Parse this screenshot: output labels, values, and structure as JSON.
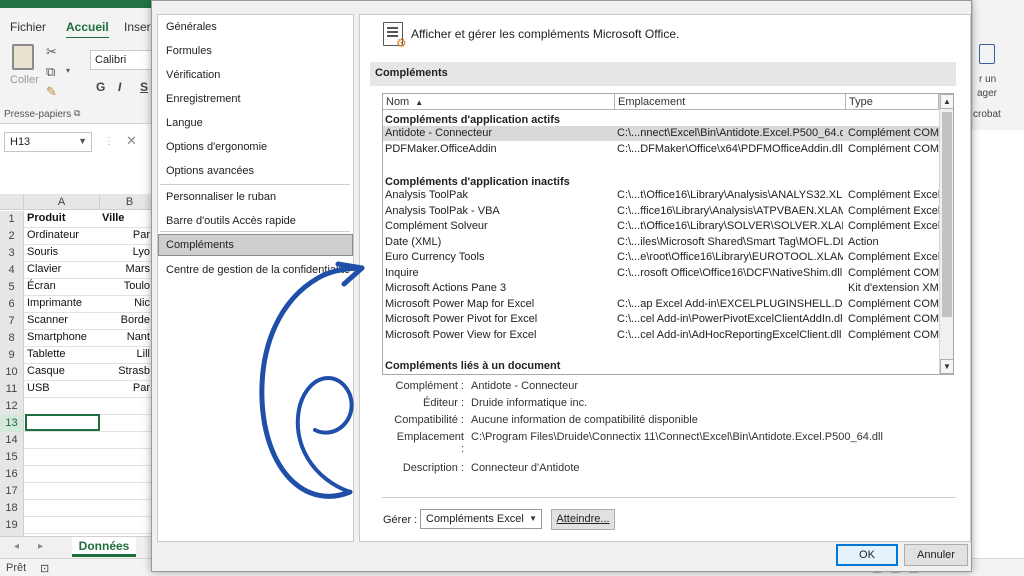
{
  "excel": {
    "tabs": [
      "Fichier",
      "Accueil",
      "Inser"
    ],
    "paste_label": "Coller",
    "font_name": "Calibri",
    "format_buttons": [
      "G",
      "I",
      "S"
    ],
    "clipboard_group": "Presse-papiers",
    "name_box": "H13",
    "right_ribbon": [
      "r un",
      "ager",
      "crobat"
    ],
    "column_headers": [
      "A",
      "B"
    ],
    "rows": [
      {
        "n": "1",
        "a": "Produit",
        "b": "Ville"
      },
      {
        "n": "2",
        "a": "Ordinateur",
        "b": "Par"
      },
      {
        "n": "3",
        "a": "Souris",
        "b": "Lyo"
      },
      {
        "n": "4",
        "a": "Clavier",
        "b": "Mars"
      },
      {
        "n": "5",
        "a": "Écran",
        "b": "Toulo"
      },
      {
        "n": "6",
        "a": "Imprimante",
        "b": "Nic"
      },
      {
        "n": "7",
        "a": "Scanner",
        "b": "Borde"
      },
      {
        "n": "8",
        "a": "Smartphone",
        "b": "Nant"
      },
      {
        "n": "9",
        "a": "Tablette",
        "b": "Lill"
      },
      {
        "n": "10",
        "a": "Casque",
        "b": "Strasb"
      },
      {
        "n": "11",
        "a": "USB",
        "b": "Par"
      },
      {
        "n": "12",
        "a": "",
        "b": ""
      },
      {
        "n": "13",
        "a": "",
        "b": ""
      },
      {
        "n": "14",
        "a": "",
        "b": ""
      },
      {
        "n": "15",
        "a": "",
        "b": ""
      },
      {
        "n": "16",
        "a": "",
        "b": ""
      },
      {
        "n": "17",
        "a": "",
        "b": ""
      },
      {
        "n": "18",
        "a": "",
        "b": ""
      },
      {
        "n": "19",
        "a": "",
        "b": ""
      },
      {
        "n": "20",
        "a": "",
        "b": ""
      }
    ],
    "sheet_tab": "Données",
    "status_ready": "Prêt"
  },
  "dialog": {
    "nav": {
      "items": [
        "Générales",
        "Formules",
        "Vérification",
        "Enregistrement",
        "Langue",
        "Options d'ergonomie",
        "Options avancées"
      ],
      "items2": [
        "Personnaliser le ruban",
        "Barre d'outils Accès rapide"
      ],
      "selected": "Compléments",
      "items3": [
        "Centre de gestion de la confidentialité"
      ]
    },
    "header_title": "Afficher et gérer les compléments Microsoft Office.",
    "section_title": "Compléments",
    "list": {
      "col_name": "Nom",
      "col_location": "Emplacement",
      "col_type": "Type",
      "group_active": "Compléments d'application actifs",
      "active": [
        {
          "name": "Antidote - Connecteur",
          "location": "C:\\...nnect\\Excel\\Bin\\Antidote.Excel.P500_64.dll",
          "type": "Complément COM"
        },
        {
          "name": "PDFMaker.OfficeAddin",
          "location": "C:\\...DFMaker\\Office\\x64\\PDFMOfficeAddin.dll",
          "type": "Complément COM"
        }
      ],
      "group_inactive": "Compléments d'application inactifs",
      "inactive": [
        {
          "name": "Analysis ToolPak",
          "location": "C:\\...t\\Office16\\Library\\Analysis\\ANALYS32.XLL",
          "type": "Complément Excel"
        },
        {
          "name": "Analysis ToolPak - VBA",
          "location": "C:\\...ffice16\\Library\\Analysis\\ATPVBAEN.XLAM",
          "type": "Complément Excel"
        },
        {
          "name": "Complément Solveur",
          "location": "C:\\...t\\Office16\\Library\\SOLVER\\SOLVER.XLAM",
          "type": "Complément Excel"
        },
        {
          "name": "Date (XML)",
          "location": "C:\\...iles\\Microsoft Shared\\Smart Tag\\MOFL.DLL",
          "type": "Action"
        },
        {
          "name": "Euro Currency Tools",
          "location": "C:\\...e\\root\\Office16\\Library\\EUROTOOL.XLAM",
          "type": "Complément Excel"
        },
        {
          "name": "Inquire",
          "location": "C:\\...rosoft Office\\Office16\\DCF\\NativeShim.dll",
          "type": "Complément COM"
        },
        {
          "name": "Microsoft Actions Pane 3",
          "location": "",
          "type": "Kit d'extension XML"
        },
        {
          "name": "Microsoft Power Map for Excel",
          "location": "C:\\...ap Excel Add-in\\EXCELPLUGINSHELL.DLL",
          "type": "Complément COM"
        },
        {
          "name": "Microsoft Power Pivot for Excel",
          "location": "C:\\...cel Add-in\\PowerPivotExcelClientAddIn.dll",
          "type": "Complément COM"
        },
        {
          "name": "Microsoft Power View for Excel",
          "location": "C:\\...cel Add-in\\AdHocReportingExcelClient.dll",
          "type": "Complément COM"
        }
      ],
      "group_document": "Compléments liés à un document"
    },
    "details": {
      "addin_label": "Complément :",
      "addin_value": "Antidote - Connecteur",
      "publisher_label": "Éditeur :",
      "publisher_value": "Druide informatique inc.",
      "compat_label": "Compatibilité :",
      "compat_value": "Aucune information de compatibilité disponible",
      "location_label": "Emplacement :",
      "location_value": "C:\\Program Files\\Druide\\Connectix 11\\Connect\\Excel\\Bin\\Antidote.Excel.P500_64.dll",
      "description_label": "Description :",
      "description_value": "Connecteur d'Antidote"
    },
    "manage_label": "Gérer :",
    "manage_value": "Compléments Excel",
    "go_button": "Atteindre...",
    "ok_button": "OK",
    "cancel_button": "Annuler"
  },
  "colors": {
    "excel_green": "#217346",
    "annotation_blue": "#1f4fa8",
    "ok_border": "#0078d7"
  }
}
